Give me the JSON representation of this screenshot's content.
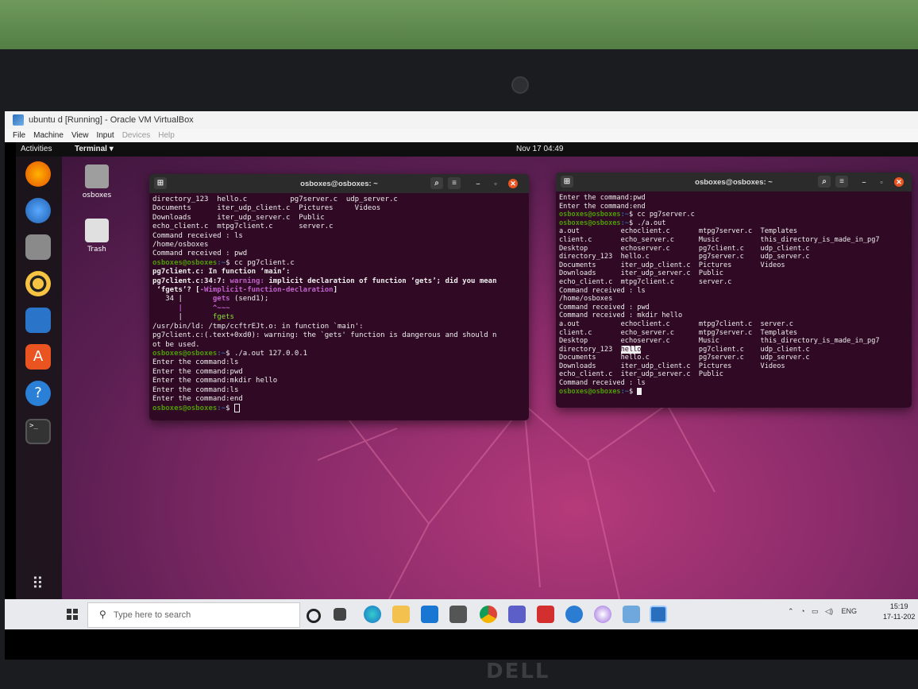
{
  "vbox": {
    "title": "ubuntu d [Running] - Oracle VM VirtualBox",
    "menu": [
      "File",
      "Machine",
      "View",
      "Input",
      "Devices",
      "Help"
    ]
  },
  "ubuntu": {
    "activities": "Activities",
    "app_menu": "Terminal ▾",
    "clock": "Nov 17  04:49",
    "desktop_icons": [
      "osboxes",
      "Trash"
    ]
  },
  "terminal_left": {
    "title": "osboxes@osboxes: ~",
    "lines": {
      "l1": "directory_123  hello.c          pg7server.c  udp_server.c",
      "l2": "Documents      iter_udp_client.c  Pictures     Videos",
      "l3": "Downloads      iter_udp_server.c  Public",
      "l4": "echo_client.c  mtpg7client.c      server.c",
      "l5": "Command received : ls",
      "l6": "/home/osboxes",
      "l7": "Command received : pwd",
      "l8_prompt": "osboxes@osboxes",
      "l8_path": ":~",
      "l8_cmd": "$ cc pg7client.c",
      "l9": "pg7client.c: In function ‘main’:",
      "l10_a": "pg7client.c:34:7: ",
      "l10_b": "warning: ",
      "l10_c": "implicit declaration of function ‘gets’; did you mean",
      "l11_a": " ‘fgets’? [",
      "l11_b": "-Wimplicit-function-declaration",
      "l11_c": "]",
      "l12_a": "   34 |       ",
      "l12_b": "gets",
      "l12_c": " (send1);",
      "l13": "      |       ^~~~",
      "l14_a": "      |       ",
      "l14_b": "fgets",
      "l15": "/usr/bin/ld: /tmp/ccftrEJt.o: in function `main':",
      "l16": "pg7client.c:(.text+0xd0): warning: the `gets' function is dangerous and should n",
      "l17": "ot be used.",
      "l18_cmd": "$ ./a.out 127.0.0.1",
      "l19": "Enter the command:ls",
      "l20": "Enter the command:pwd",
      "l21": "Enter the command:mkdir hello",
      "l22": "Enter the command:ls",
      "l23": "Enter the command:end",
      "l24_cmd": "$ "
    }
  },
  "terminal_right": {
    "title": "osboxes@osboxes: ~",
    "lines": {
      "r1": "Enter the command:pwd",
      "r2": "Enter the command:end",
      "r3_prompt": "osboxes@osboxes",
      "r3_path": ":~",
      "r3_cmd": "$ cc pg7server.c",
      "r4_cmd": "$ ./a.out",
      "r5": "a.out          echoclient.c       mtpg7server.c  Templates",
      "r6": "client.c       echo_server.c      Music          this_directory_is_made_in_pg7",
      "r7": "Desktop        echoserver.c       pg7client.c    udp_client.c",
      "r8": "directory_123  hello.c            pg7server.c    udp_server.c",
      "r9": "Documents      iter_udp_client.c  Pictures       Videos",
      "r10": "Downloads      iter_udp_server.c  Public",
      "r11": "echo_client.c  mtpg7client.c      server.c",
      "r12": "Command received : ls",
      "r13": "/home/osboxes",
      "r14": "Command received : pwd",
      "r15": "Command received : mkdir hello",
      "r16": "a.out          echoclient.c       mtpg7client.c  server.c",
      "r17": "client.c       echo_server.c      mtpg7server.c  Templates",
      "r18": "Desktop        echoserver.c       Music          this_directory_is_made_in_pg7",
      "r19_a": "directory_123  ",
      "r19_hl": "hello",
      "r19_b": "              pg7client.c    udp_client.c",
      "r20": "Documents      hello.c            pg7server.c    udp_server.c",
      "r21": "Downloads      iter_udp_client.c  Pictures       Videos",
      "r22": "echo_client.c  iter_udp_server.c  Public",
      "r23": "Command received : ls",
      "r24_cmd": "$ "
    }
  },
  "windows_taskbar": {
    "search_placeholder": "Type here to search",
    "lang": "ENG",
    "time": "15:19",
    "date": "17-11-202"
  },
  "brand": "DELL",
  "colors": {
    "terminal_bg": "#300a24",
    "prompt_user": "#4e9a06",
    "prompt_path": "#3465a4",
    "warning": "#c061cb",
    "ubuntu_orange": "#e95420"
  }
}
